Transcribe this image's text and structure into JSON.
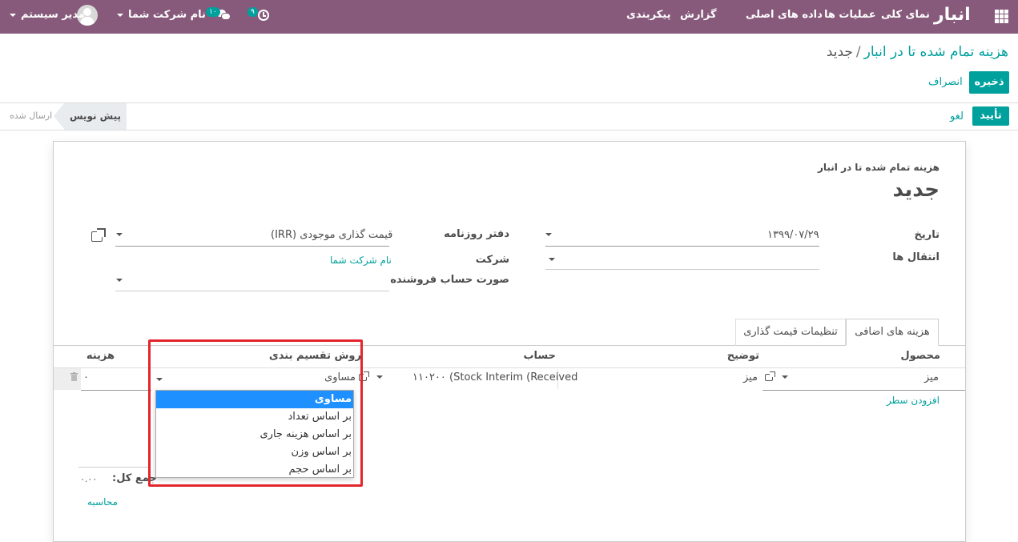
{
  "navbar": {
    "app_title": "انبار",
    "menu": [
      "نمای کلی",
      "عملیات ها",
      "داده های اصلی",
      "گزارش",
      "پیکربندی"
    ],
    "activity_count": "۹",
    "messages_count": "۱۰",
    "company": "نام شرکت شما",
    "user": "مدیر سیستم",
    "bg_color": "#875a7b"
  },
  "control": {
    "breadcrumb_parent": "هزینه تمام شده تا در انبار",
    "breadcrumb_sep": "/",
    "breadcrumb_current": "جدید",
    "save_label": "ذخیره",
    "discard_label": "انصراف"
  },
  "status": {
    "confirm_label": "تأیید",
    "cancel_label": "لغو",
    "stages": [
      "پیش نویس",
      "ارسال شده"
    ],
    "current_stage": "پیش نویس"
  },
  "form": {
    "subtitle": "هزینه تمام شده تا در انبار",
    "title": "جدید",
    "date_label": "تاریخ",
    "date_value": "۱۳۹۹/۰۷/۲۹",
    "transfers_label": "انتقال ها",
    "journal_label": "دفتر روزنامه",
    "journal_value": "قیمت گذاری موجودی (IRR)",
    "company_label": "شرکت",
    "company_value": "نام شرکت شما",
    "vendor_bill_label": "صورت حساب فروشنده"
  },
  "tabs": [
    "هزینه های اضافی",
    "تنظیمات قیمت گذاری"
  ],
  "table": {
    "columns": [
      "محصول",
      "توضیح",
      "حساب",
      "روش تقسیم بندی",
      "هزینه"
    ],
    "row": {
      "product": "میز",
      "description": "میز",
      "account": "۱۱۰۲۰۰ (Stock Interim (Received",
      "split_method": "مساوی",
      "cost": "۰"
    },
    "add_line": "افزودن سطر",
    "total_label": "جمع کل:",
    "total_value": "۰.۰۰",
    "compute_label": "محاسبه"
  },
  "dropdown": {
    "options": [
      "مساوی",
      "بر اساس تعداد",
      "بر اساس هزینه جاری",
      "بر اساس وزن",
      "بر اساس حجم"
    ],
    "selected": "مساوی"
  },
  "colors": {
    "accent": "#00a09d",
    "highlight": "#e3262e",
    "selected_option": "#1e90ff"
  }
}
